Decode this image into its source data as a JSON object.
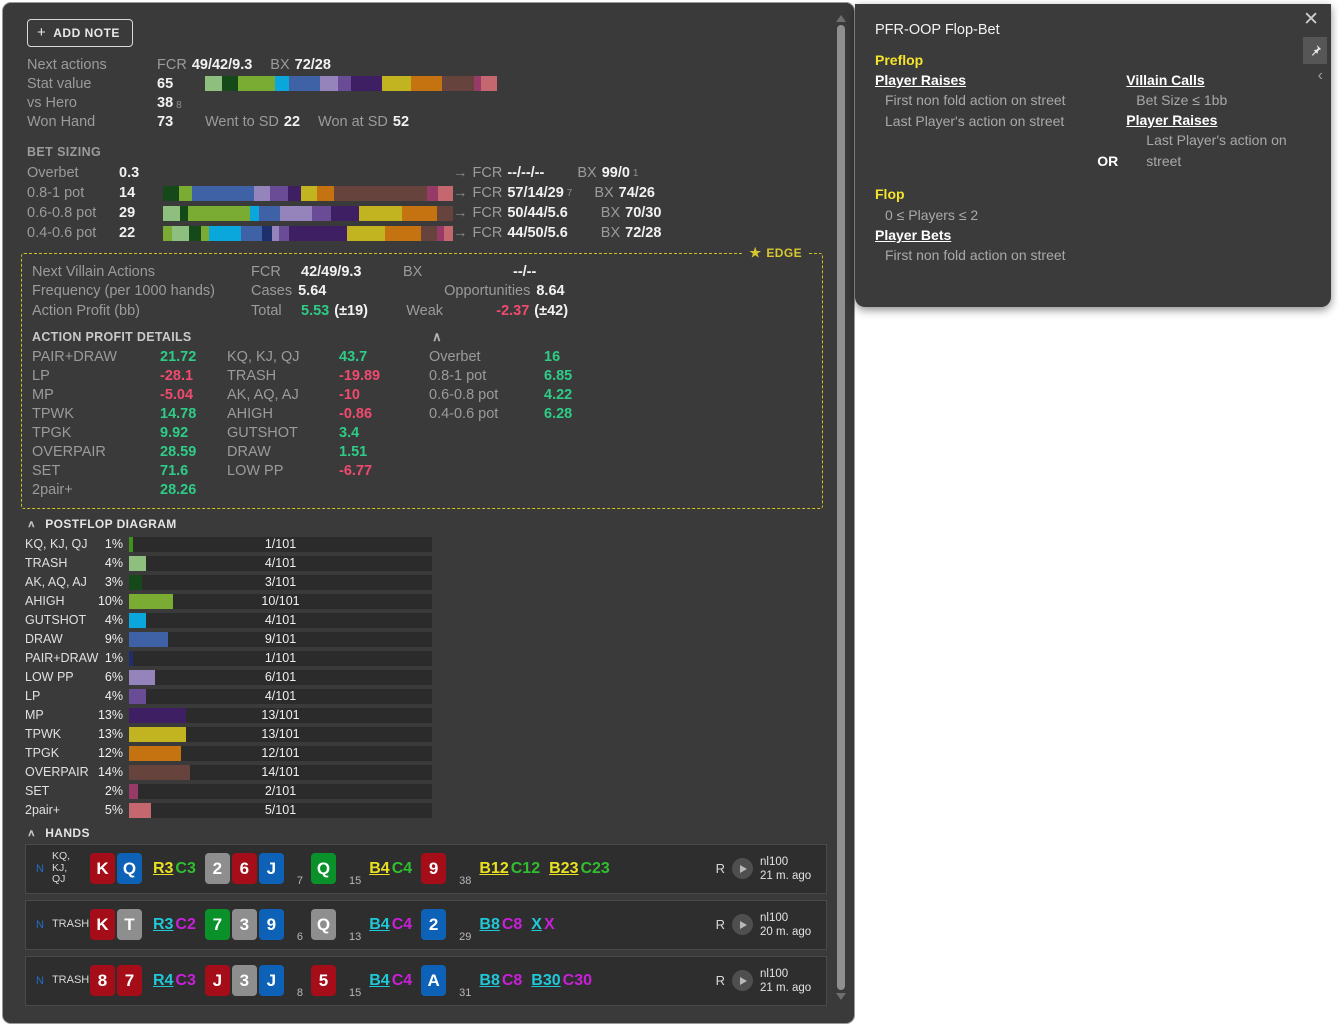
{
  "hud": {
    "add_note_label": "ADD NOTE",
    "next_actions": {
      "label": "Next actions",
      "fcr_key": "FCR",
      "fcr_value": "49/42/9.3",
      "bx_key": "BX",
      "bx_value": "72/28"
    },
    "stat_value": {
      "label": "Stat value",
      "value": "65"
    },
    "vs_hero": {
      "label": "vs Hero",
      "value": "38",
      "sub": "8"
    },
    "won_hand": {
      "label": "Won Hand",
      "value": "73",
      "went_sd_key": "Went to SD",
      "went_sd_value": "22",
      "won_sd_key": "Won at SD",
      "won_sd_value": "52"
    },
    "stat_bar": [
      {
        "color": "#8fbf7f",
        "w": 7.0
      },
      {
        "color": "#16491a",
        "w": 6.5
      },
      {
        "color": "#7aab32",
        "w": 15.5
      },
      {
        "color": "#09a7dc",
        "w": 6.0
      },
      {
        "color": "#3e62a5",
        "w": 12.5
      },
      {
        "color": "#9583bb",
        "w": 7.5
      },
      {
        "color": "#6a4b96",
        "w": 5.5
      },
      {
        "color": "#3f1f63",
        "w": 13.0
      },
      {
        "color": "#c2b420",
        "w": 12.0
      },
      {
        "color": "#c57311",
        "w": 12.5
      },
      {
        "color": "#66433c",
        "w": 13.5
      },
      {
        "color": "#963a68",
        "w": 3.0
      },
      {
        "color": "#c4676f",
        "w": 6.5
      }
    ],
    "bet_sizing": {
      "title": "BET SIZING",
      "rows": [
        {
          "label": "Overbet",
          "value": "0.3",
          "fcr": "--/--/--",
          "fcr_sub": "",
          "bx": "99/0",
          "bx_sub": "1",
          "bar": []
        },
        {
          "label": "0.8-1 pot",
          "value": "14",
          "fcr": "57/14/29",
          "fcr_sub": "7",
          "bx": "74/26",
          "bx_sub": "",
          "bar": [
            {
              "color": "#16491a",
              "w": 5.5
            },
            {
              "color": "#7aab32",
              "w": 4.5
            },
            {
              "color": "#3e62a5",
              "w": 21.5
            },
            {
              "color": "#9583bb",
              "w": 5.5
            },
            {
              "color": "#6a4b96",
              "w": 6.0
            },
            {
              "color": "#3f1f63",
              "w": 4.5
            },
            {
              "color": "#c2b420",
              "w": 5.5
            },
            {
              "color": "#c57311",
              "w": 6.0
            },
            {
              "color": "#66433c",
              "w": 32.0
            },
            {
              "color": "#963a68",
              "w": 4.0
            },
            {
              "color": "#c4676f",
              "w": 5.0
            }
          ]
        },
        {
          "label": "0.6-0.8 pot",
          "value": "29",
          "fcr": "50/44/5.6",
          "fcr_sub": "",
          "bx": "70/30",
          "bx_sub": "",
          "bar": [
            {
              "color": "#8fbf7f",
              "w": 6.0
            },
            {
              "color": "#16491a",
              "w": 2.5
            },
            {
              "color": "#7aab32",
              "w": 21.5
            },
            {
              "color": "#09a7dc",
              "w": 3.0
            },
            {
              "color": "#3e62a5",
              "w": 7.5
            },
            {
              "color": "#9583bb",
              "w": 11.0
            },
            {
              "color": "#6a4b96",
              "w": 6.5
            },
            {
              "color": "#3f1f63",
              "w": 9.5
            },
            {
              "color": "#c2b420",
              "w": 15.0
            },
            {
              "color": "#c57311",
              "w": 12.0
            },
            {
              "color": "#66433c",
              "w": 5.5
            }
          ]
        },
        {
          "label": "0.4-0.6 pot",
          "value": "22",
          "fcr": "44/50/5.6",
          "fcr_sub": "",
          "bx": "72/28",
          "bx_sub": "",
          "bar": [
            {
              "color": "#7aab32",
              "w": 3.0
            },
            {
              "color": "#8fbf7f",
              "w": 6.0
            },
            {
              "color": "#16491a",
              "w": 4.0
            },
            {
              "color": "#7aab32",
              "w": 3.0
            },
            {
              "color": "#09a7dc",
              "w": 11.0
            },
            {
              "color": "#3e62a5",
              "w": 7.0
            },
            {
              "color": "#1f2f6e",
              "w": 3.5
            },
            {
              "color": "#9583bb",
              "w": 2.5
            },
            {
              "color": "#6a4b96",
              "w": 3.5
            },
            {
              "color": "#3f1f63",
              "w": 20.0
            },
            {
              "color": "#c2b420",
              "w": 13.0
            },
            {
              "color": "#c57311",
              "w": 12.5
            },
            {
              "color": "#66433c",
              "w": 5.5
            },
            {
              "color": "#963a68",
              "w": 2.5
            },
            {
              "color": "#c4676f",
              "w": 3.0
            }
          ]
        }
      ],
      "arrow": "→",
      "fcr_key": "FCR",
      "bx_key": "BX"
    },
    "edge": {
      "tag": "EDGE",
      "star": "★",
      "row1": {
        "label": "Next Villain Actions",
        "fcr_key": "FCR",
        "fcr_value": "42/49/9.3",
        "bx_key": "BX",
        "bx_value": "--/--"
      },
      "row2": {
        "label": "Frequency (per 1000 hands)",
        "cases_key": "Cases",
        "cases_value": "5.64",
        "opp_key": "Opportunities",
        "opp_value": "8.64"
      },
      "row3": {
        "label": "Action Profit (bb)",
        "total_key": "Total",
        "total_value": "5.53",
        "total_err": "(±19)",
        "weak_key": "Weak",
        "weak_value": "-2.37",
        "weak_err": "(±42)"
      },
      "details_title": "ACTION PROFIT DETAILS",
      "details_caret": "∧",
      "col1": [
        {
          "name": "PAIR+DRAW",
          "value": "21.72",
          "sign": "pos"
        },
        {
          "name": "LP",
          "value": "-28.1",
          "sign": "neg"
        },
        {
          "name": "MP",
          "value": "-5.04",
          "sign": "neg"
        },
        {
          "name": "TPWK",
          "value": "14.78",
          "sign": "pos"
        },
        {
          "name": "TPGK",
          "value": "9.92",
          "sign": "pos"
        },
        {
          "name": "OVERPAIR",
          "value": "28.59",
          "sign": "pos"
        },
        {
          "name": "SET",
          "value": "71.6",
          "sign": "pos"
        },
        {
          "name": "2pair+",
          "value": "28.26",
          "sign": "pos"
        }
      ],
      "col2": [
        {
          "name": "KQ, KJ, QJ",
          "value": "43.7",
          "sign": "pos"
        },
        {
          "name": "TRASH",
          "value": "-19.89",
          "sign": "neg"
        },
        {
          "name": "AK, AQ, AJ",
          "value": "-10",
          "sign": "neg"
        },
        {
          "name": "AHIGH",
          "value": "-0.86",
          "sign": "neg"
        },
        {
          "name": "GUTSHOT",
          "value": "3.4",
          "sign": "pos"
        },
        {
          "name": "DRAW",
          "value": "1.51",
          "sign": "pos"
        },
        {
          "name": "LOW PP",
          "value": "-6.77",
          "sign": "neg"
        }
      ],
      "col3": [
        {
          "name": "Overbet",
          "value": "16",
          "sign": "pos"
        },
        {
          "name": "0.8-1 pot",
          "value": "6.85",
          "sign": "pos"
        },
        {
          "name": "0.6-0.8 pot",
          "value": "4.22",
          "sign": "pos"
        },
        {
          "name": "0.4-0.6 pot",
          "value": "6.28",
          "sign": "pos"
        }
      ]
    },
    "postflop": {
      "title": "POSTFLOP DIAGRAM",
      "caret": "∧"
    },
    "hands": {
      "title": "HANDS",
      "caret": "∧",
      "rows": [
        {
          "n": "N",
          "category": "KQ,\nKJ,\nQJ",
          "hole": [
            {
              "rank": "K",
              "color": "c-red"
            },
            {
              "rank": "Q",
              "color": "c-blue"
            }
          ],
          "streets": [
            {
              "bet": "R3",
              "bet_color": "#e8e020",
              "call": "C3",
              "call_color": "#2fbf2f",
              "board": [],
              "pot": ""
            },
            {
              "bet": "",
              "bet_color": "",
              "call": "",
              "call_color": "",
              "board": [
                {
                  "rank": "2",
                  "color": "c-gray"
                },
                {
                  "rank": "6",
                  "color": "c-red"
                },
                {
                  "rank": "J",
                  "color": "c-blue"
                }
              ],
              "pot": "7"
            },
            {
              "bet": "B4",
              "bet_color": "#e8e020",
              "call": "C4",
              "call_color": "#2fbf2f",
              "board": [
                {
                  "rank": "Q",
                  "color": "c-green"
                }
              ],
              "pot": "15"
            },
            {
              "bet": "B12",
              "bet_color": "#e8e020",
              "call": "C12",
              "call_color": "#2fbf2f",
              "board": [
                {
                  "rank": "9",
                  "color": "c-red"
                }
              ],
              "pot": "38"
            },
            {
              "bet": "B23",
              "bet_color": "#e8e020",
              "call": "C23",
              "call_color": "#2fbf2f",
              "board": [],
              "pot": ""
            }
          ],
          "result": "R",
          "stake": "nl100",
          "time": "21 m. ago"
        },
        {
          "n": "N",
          "category": "TRASH",
          "hole": [
            {
              "rank": "K",
              "color": "c-red"
            },
            {
              "rank": "T",
              "color": "c-gray"
            }
          ],
          "streets": [
            {
              "bet": "R3",
              "bet_color": "#1fc8d8",
              "call": "C2",
              "call_color": "#c820d8",
              "board": [],
              "pot": ""
            },
            {
              "bet": "",
              "bet_color": "",
              "call": "",
              "call_color": "",
              "board": [
                {
                  "rank": "7",
                  "color": "c-green"
                },
                {
                  "rank": "3",
                  "color": "c-gray"
                },
                {
                  "rank": "9",
                  "color": "c-blue"
                }
              ],
              "pot": "6"
            },
            {
              "bet": "B4",
              "bet_color": "#1fc8d8",
              "call": "C4",
              "call_color": "#c820d8",
              "board": [
                {
                  "rank": "Q",
                  "color": "c-gray"
                }
              ],
              "pot": "13"
            },
            {
              "bet": "B8",
              "bet_color": "#1fc8d8",
              "call": "C8",
              "call_color": "#c820d8",
              "board": [
                {
                  "rank": "2",
                  "color": "c-blue"
                }
              ],
              "pot": "29"
            },
            {
              "bet": "X",
              "bet_color": "#1fc8d8",
              "call": "X",
              "call_color": "#c820d8",
              "board": [],
              "pot": ""
            }
          ],
          "result": "R",
          "stake": "nl100",
          "time": "20 m. ago"
        },
        {
          "n": "N",
          "category": "TRASH",
          "hole": [
            {
              "rank": "8",
              "color": "c-red"
            },
            {
              "rank": "7",
              "color": "c-red"
            }
          ],
          "streets": [
            {
              "bet": "R4",
              "bet_color": "#1fc8d8",
              "call": "C3",
              "call_color": "#c820d8",
              "board": [],
              "pot": ""
            },
            {
              "bet": "",
              "bet_color": "",
              "call": "",
              "call_color": "",
              "board": [
                {
                  "rank": "J",
                  "color": "c-red"
                },
                {
                  "rank": "3",
                  "color": "c-gray"
                },
                {
                  "rank": "J",
                  "color": "c-blue"
                }
              ],
              "pot": "8"
            },
            {
              "bet": "B4",
              "bet_color": "#1fc8d8",
              "call": "C4",
              "call_color": "#c820d8",
              "board": [
                {
                  "rank": "5",
                  "color": "c-red"
                }
              ],
              "pot": "15"
            },
            {
              "bet": "B8",
              "bet_color": "#1fc8d8",
              "call": "C8",
              "call_color": "#c820d8",
              "board": [
                {
                  "rank": "A",
                  "color": "c-blue"
                }
              ],
              "pot": "31"
            },
            {
              "bet": "B30",
              "bet_color": "#1fc8d8",
              "call": "C30",
              "call_color": "#c820d8",
              "board": [],
              "pot": ""
            }
          ],
          "result": "R",
          "stake": "nl100",
          "time": "21 m. ago"
        }
      ]
    }
  },
  "chart_data": {
    "type": "bar",
    "title": "POSTFLOP DIAGRAM",
    "xlabel": "",
    "ylabel": "",
    "total": 101,
    "xlim": [
      0,
      50
    ],
    "grid": false,
    "legend": "none",
    "categories": [
      "KQ, KJ, QJ",
      "TRASH",
      "AK, AQ, AJ",
      "AHIGH",
      "GUTSHOT",
      "DRAW",
      "PAIR+DRAW",
      "LOW PP",
      "LP",
      "MP",
      "TPWK",
      "TPGK",
      "OVERPAIR",
      "SET",
      "2pair+"
    ],
    "values": [
      1,
      4,
      3,
      10,
      4,
      9,
      1,
      6,
      4,
      13,
      13,
      12,
      14,
      2,
      5
    ],
    "percents": [
      "1%",
      "4%",
      "3%",
      "10%",
      "4%",
      "9%",
      "1%",
      "6%",
      "4%",
      "13%",
      "13%",
      "12%",
      "14%",
      "2%",
      "5%"
    ],
    "counts": [
      "1/101",
      "4/101",
      "3/101",
      "10/101",
      "4/101",
      "9/101",
      "1/101",
      "6/101",
      "4/101",
      "13/101",
      "13/101",
      "12/101",
      "14/101",
      "2/101",
      "5/101"
    ],
    "colors": [
      "#3f9120",
      "#8fbf7f",
      "#16491a",
      "#7aab32",
      "#09a7dc",
      "#3e62a5",
      "#1f2f6e",
      "#9583bb",
      "#6a4b96",
      "#3f1f63",
      "#c2b420",
      "#c57311",
      "#66433c",
      "#963a68",
      "#c4676f"
    ]
  },
  "tooltip": {
    "title": "PFR-OOP Flop-Bet",
    "close_icon": "✕",
    "pin_icon": "📌",
    "collapse_icon": "‹",
    "sections": [
      {
        "street": "Preflop",
        "left_head": "Player Raises",
        "left_lines": [
          "First non fold action on street",
          "Last Player's action on street"
        ],
        "or_label": "OR",
        "right_head": "Villain Calls",
        "right_lines": [
          "Bet Size ≤ 1bb"
        ],
        "right_head2": "Player Raises",
        "right_lines2": [
          "Last Player's action on street"
        ]
      },
      {
        "street": "Flop",
        "condition": "0 ≤ Players ≤ 2",
        "left_head": "Player Bets",
        "left_lines": [
          "First non fold action on street"
        ]
      }
    ]
  }
}
